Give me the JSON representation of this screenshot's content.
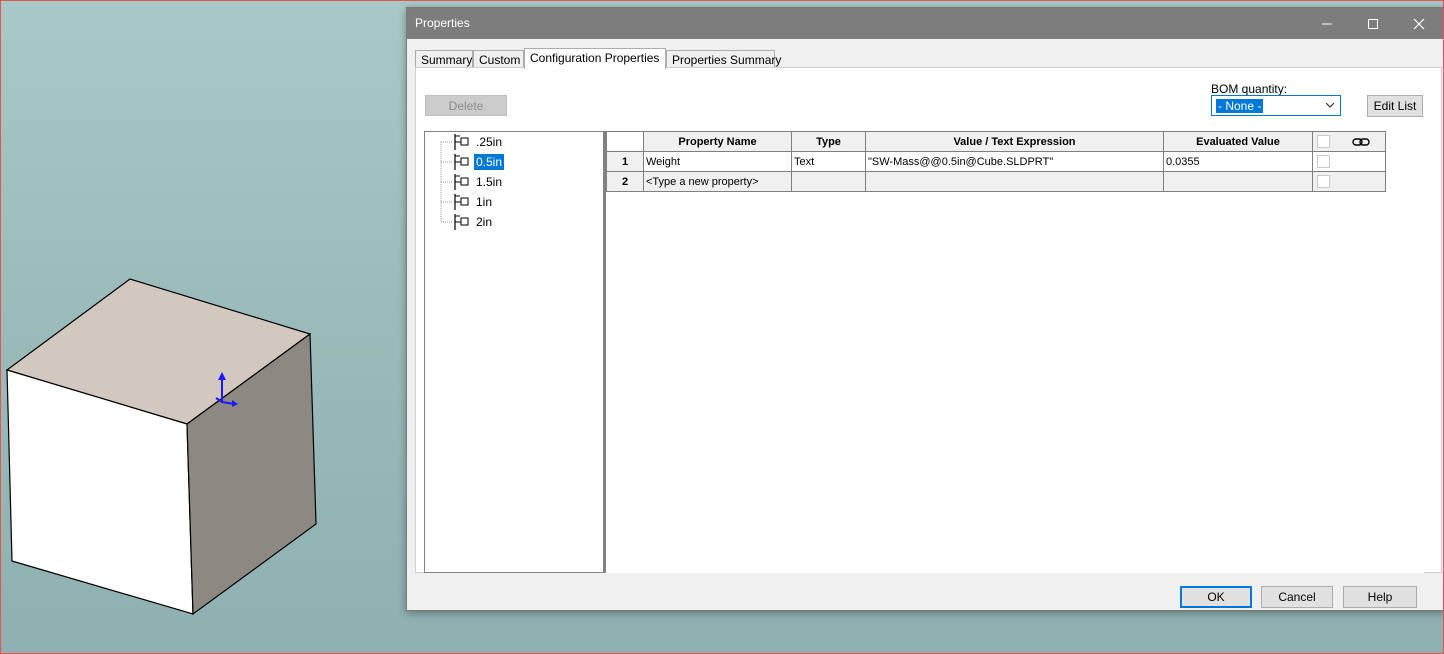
{
  "dialog": {
    "title": "Properties",
    "tabs": [
      "Summary",
      "Custom",
      "Configuration Properties",
      "Properties Summary"
    ],
    "active_tab": "Configuration Properties",
    "delete_label": "Delete",
    "bom_label": "BOM quantity:",
    "bom_value": "- None -",
    "edit_list_label": "Edit List",
    "configurations": [
      ".25in",
      "0.5in",
      "1.5in",
      "1in",
      "2in"
    ],
    "selected_configuration": "0.5in",
    "grid": {
      "headers": [
        "Property Name",
        "Type",
        "Value / Text Expression",
        "Evaluated Value"
      ],
      "rows": [
        {
          "num": "1",
          "name": "Weight",
          "type": "Text",
          "value": "\"SW-Mass@@0.5in@Cube.SLDPRT\"",
          "evaluated": "0.0355"
        },
        {
          "num": "2",
          "name": "<Type a new property>",
          "type": "",
          "value": "",
          "evaluated": ""
        }
      ]
    },
    "ok_label": "OK",
    "cancel_label": "Cancel",
    "help_label": "Help"
  },
  "colors": {
    "accent": "#0078d7",
    "titlebar": "#7d7d7d",
    "cube_top": "#d2c8c0",
    "cube_right": "#8e8882",
    "cube_left": "#ffffff"
  },
  "icons": [
    "minimize-icon",
    "maximize-icon",
    "close-icon",
    "chevron-down-icon",
    "link-icon",
    "configuration-icon",
    "triad-icon"
  ]
}
